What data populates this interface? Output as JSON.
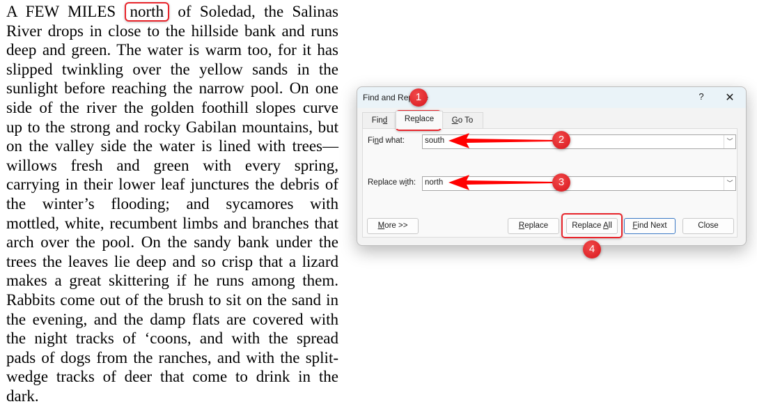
{
  "document": {
    "lines": [
      {
        "before": "A FEW MILES",
        "highlight": "north",
        "after": "of Soledad, the Salinas"
      },
      {
        "text": "River drops in close to the hillside bank and runs"
      },
      {
        "text": "deep and green. The water is warm too, for it has"
      },
      {
        "text": "slipped twinkling over the yellow sands in the"
      },
      {
        "text": "sunlight before reaching the narrow pool. On one"
      },
      {
        "text": "side of the river the golden foothill slopes curve"
      },
      {
        "text": "up to the strong and rocky Gabilan mountains, but"
      },
      {
        "text": "on the valley side the water is lined with trees—"
      },
      {
        "text": "willows fresh and green with every spring,"
      },
      {
        "text": "carrying in their lower leaf junctures the debris of"
      },
      {
        "text": "the winter’s flooding; and sycamores with"
      },
      {
        "text": "mottled, white, recumbent limbs and branches that"
      },
      {
        "text": "arch over the pool. On the sandy bank under the"
      },
      {
        "text": "trees the leaves lie deep and so crisp that a lizard"
      },
      {
        "text": "makes a great skittering if he runs among them."
      },
      {
        "text": "Rabbits come out of the brush to sit on the sand in"
      },
      {
        "text": "the evening, and the damp flats are covered with"
      },
      {
        "text": "the night tracks of ‘coons, and with the spread"
      },
      {
        "text": "pads of dogs from the ranches, and with the split-"
      },
      {
        "text": "wedge tracks of deer that come to drink in the"
      },
      {
        "text": "dark."
      }
    ]
  },
  "dialog": {
    "title": "Find and Replace",
    "help": "?",
    "close": "✕",
    "tabs": [
      {
        "label_pre": "Fin",
        "label_u": "d",
        "label_post": ""
      },
      {
        "label_pre": "Re",
        "label_u": "p",
        "label_post": "lace"
      },
      {
        "label_pre": "",
        "label_u": "G",
        "label_post": "o To"
      }
    ],
    "find": {
      "label_pre": "Fi",
      "label_u": "n",
      "label_post": "d what:",
      "value": "south"
    },
    "replace": {
      "label_pre": "Replace w",
      "label_u": "i",
      "label_post": "th:",
      "value": "north"
    },
    "buttons": {
      "more": {
        "u": "M",
        "rest": "ore >>"
      },
      "replace": {
        "u": "R",
        "rest": "eplace"
      },
      "replace_all": {
        "pre": "Replace ",
        "u": "A",
        "rest": "ll"
      },
      "find_next": {
        "u": "F",
        "rest": "ind Next"
      },
      "close": "Close"
    },
    "dropdown_icon": "chevron-down"
  },
  "annotations": {
    "color": "#e8242b",
    "badges": [
      "1",
      "2",
      "3",
      "4"
    ]
  }
}
